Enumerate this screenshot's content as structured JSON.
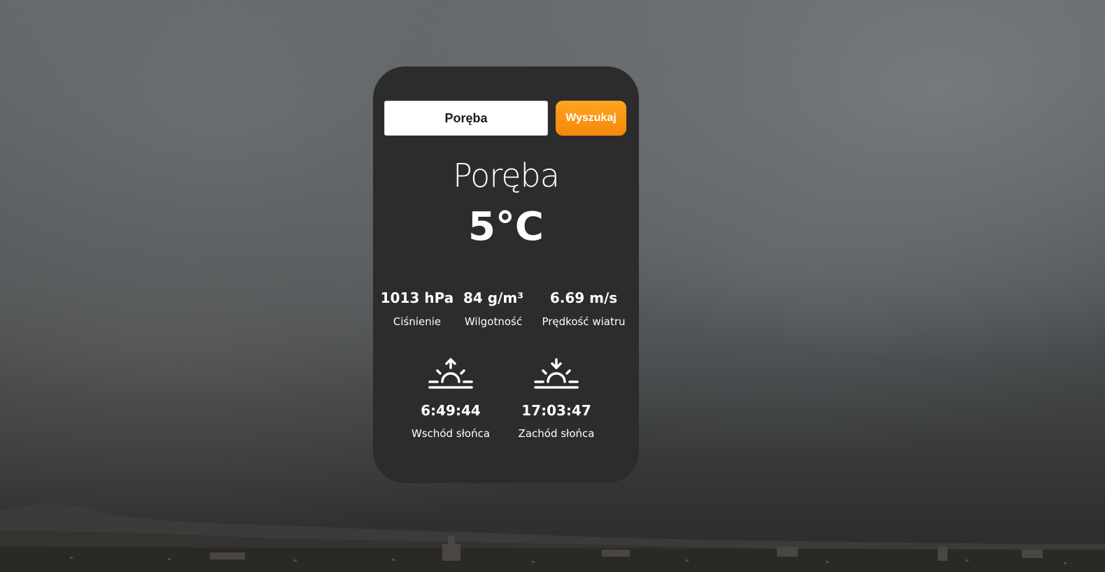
{
  "search": {
    "value": "Poręba",
    "button_label": "Wyszukaj"
  },
  "weather": {
    "city": "Poręba",
    "temperature": "5°C"
  },
  "stats": [
    {
      "value": "1013 hPa",
      "label": "Ciśnienie"
    },
    {
      "value": "84 g/m³",
      "label": "Wilgotność"
    },
    {
      "value": "6.69 m/s",
      "label": "Prędkość wiatru"
    }
  ],
  "sun": {
    "sunrise": {
      "time": "6:49:44",
      "label": "Wschód słońca",
      "icon": "sunrise-icon"
    },
    "sunset": {
      "time": "17:03:47",
      "label": "Zachód słońca",
      "icon": "sunset-icon"
    }
  },
  "colors": {
    "card": "#2c2c2c",
    "accent": "#f5870a",
    "text": "#ffffff"
  }
}
